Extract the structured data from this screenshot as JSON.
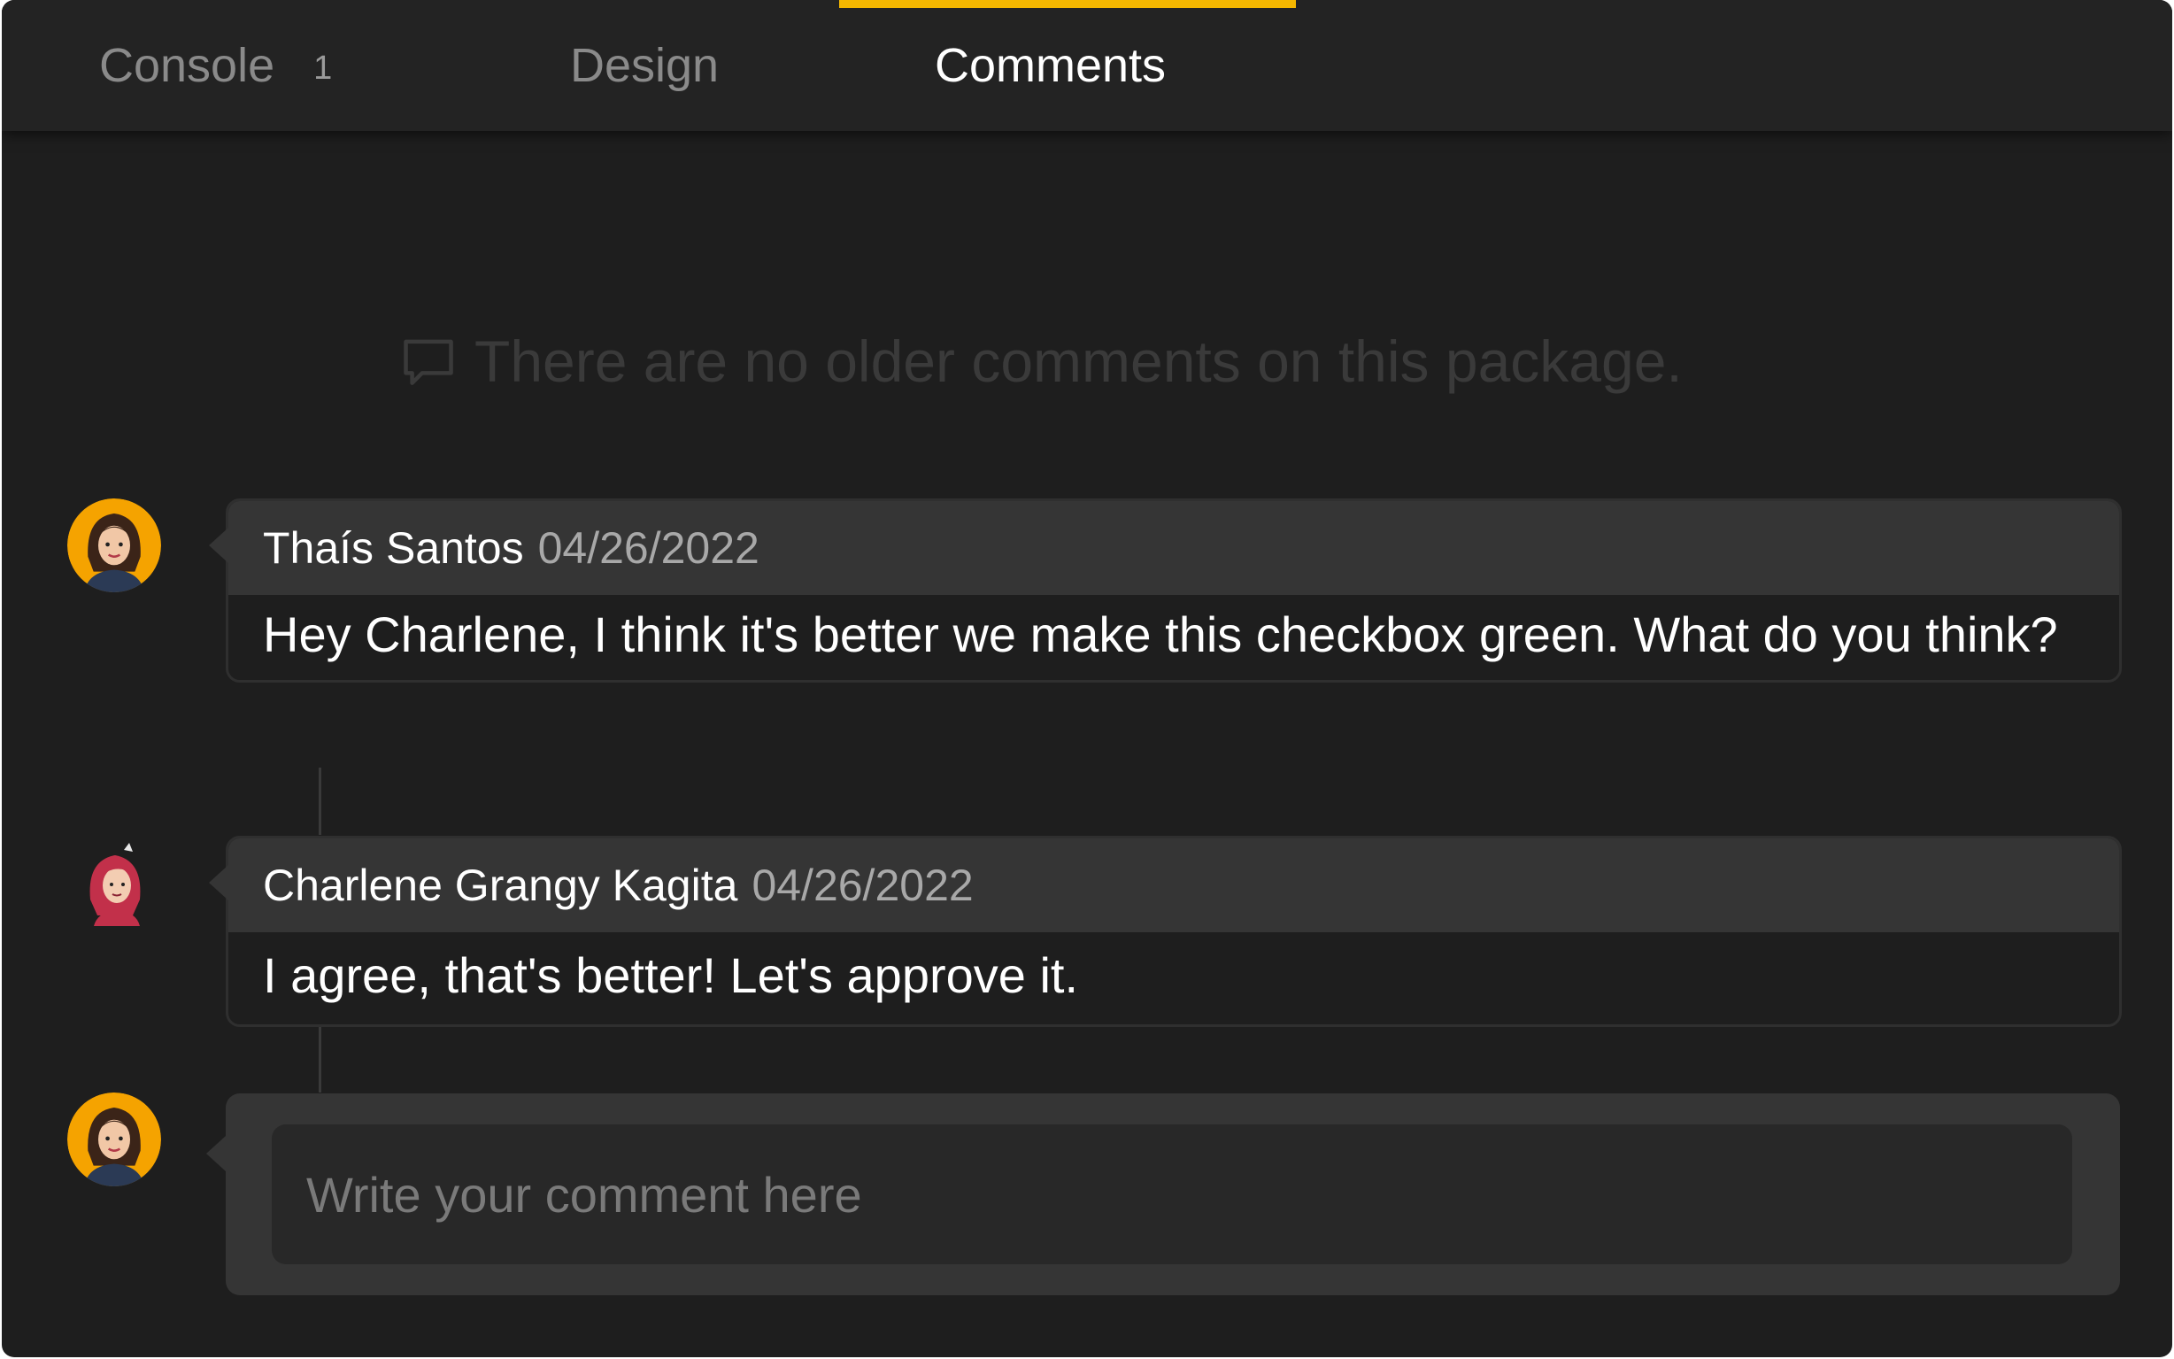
{
  "tabs": [
    {
      "label": "Console",
      "count": "1"
    },
    {
      "label": "Design"
    },
    {
      "label": "Comments",
      "active": true
    }
  ],
  "accent_color": "#f5b700",
  "empty_notice": {
    "icon": "comment-icon",
    "text": "There are no older comments on this package."
  },
  "comments": [
    {
      "author": "Thaís Santos",
      "date": "04/26/2022",
      "body": "Hey Charlene, I think it's better we make this checkbox green. What do you think?",
      "avatar": "avatar-woman-brown-hair-orange-bg"
    },
    {
      "author": "Charlene Grangy Kagita",
      "date": "04/26/2022",
      "body": "I agree, that's better! Let's approve it.",
      "avatar": "avatar-woman-red-hair"
    }
  ],
  "composer": {
    "placeholder": "Write your comment here",
    "value": "",
    "avatar": "avatar-woman-brown-hair-orange-bg"
  }
}
